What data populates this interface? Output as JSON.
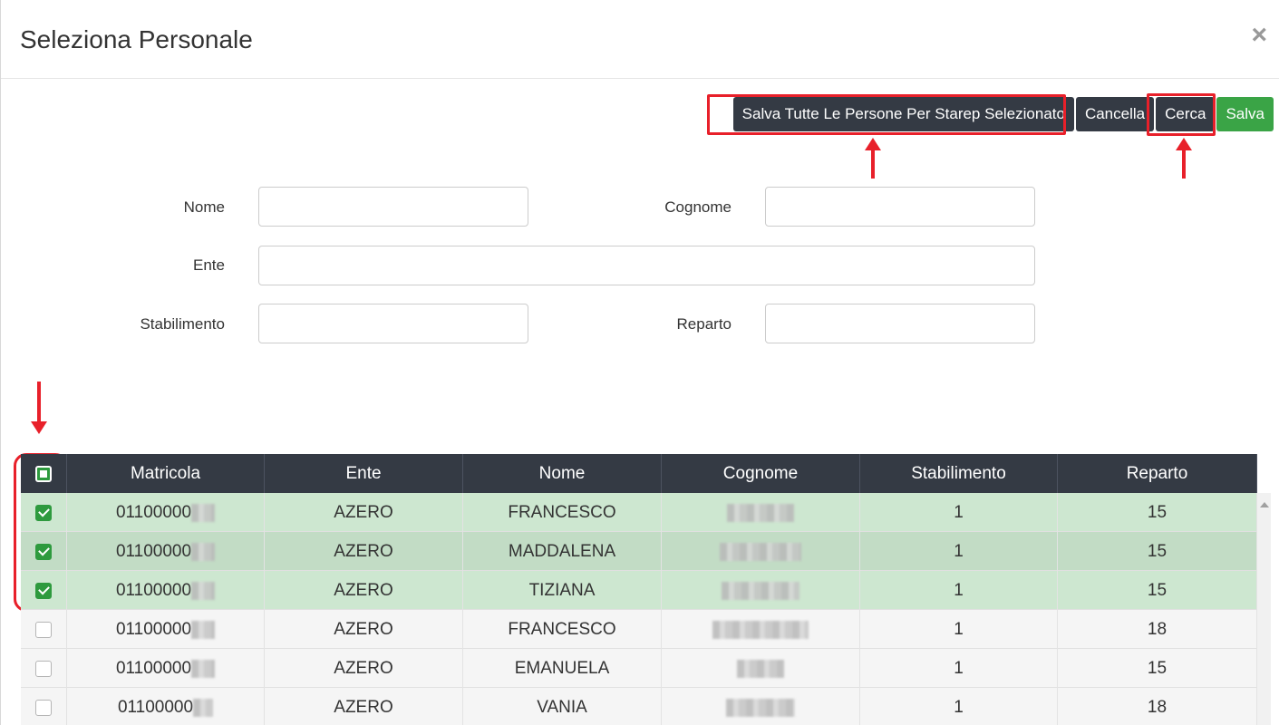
{
  "modal": {
    "title": "Seleziona Personale",
    "close_glyph": "×"
  },
  "toolbar": {
    "save_all_label": "Salva Tutte Le Persone Per Starep Selezionato",
    "cancel_label": "Cancella",
    "search_label": "Cerca",
    "save_label": "Salva"
  },
  "form": {
    "nome_label": "Nome",
    "cognome_label": "Cognome",
    "ente_label": "Ente",
    "stabilimento_label": "Stabilimento",
    "reparto_label": "Reparto",
    "nome_value": "",
    "cognome_value": "",
    "ente_value": "",
    "stabilimento_value": "",
    "reparto_value": ""
  },
  "table": {
    "columns": [
      "Matricola",
      "Ente",
      "Nome",
      "Cognome",
      "Stabilimento",
      "Reparto"
    ],
    "rows": [
      {
        "matricola": "01100000",
        "ente": "AZERO",
        "nome": "FRANCESCO",
        "stabilimento": "1",
        "reparto": "15",
        "checked": true
      },
      {
        "matricola": "01100000",
        "ente": "AZERO",
        "nome": "MADDALENA",
        "stabilimento": "1",
        "reparto": "15",
        "checked": true
      },
      {
        "matricola": "01100000",
        "ente": "AZERO",
        "nome": "TIZIANA",
        "stabilimento": "1",
        "reparto": "15",
        "checked": true
      },
      {
        "matricola": "01100000",
        "ente": "AZERO",
        "nome": "FRANCESCO",
        "stabilimento": "1",
        "reparto": "18",
        "checked": false
      },
      {
        "matricola": "01100000",
        "ente": "AZERO",
        "nome": "EMANUELA",
        "stabilimento": "1",
        "reparto": "15",
        "checked": false
      },
      {
        "matricola": "01100000",
        "ente": "AZERO",
        "nome": "VANIA",
        "stabilimento": "1",
        "reparto": "18",
        "checked": false
      }
    ]
  },
  "colors": {
    "dark": "#343a44",
    "green": "#3aa446",
    "highlight": "#e8202a",
    "selected_row": "#cde7d0"
  }
}
